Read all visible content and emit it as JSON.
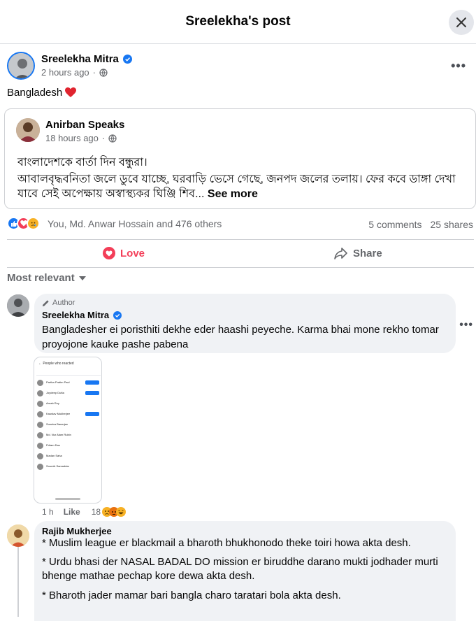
{
  "header": {
    "title": "Sreelekha's post"
  },
  "post": {
    "author": "Sreelekha Mitra",
    "time": "2 hours ago",
    "text": "Bangladesh",
    "shared": {
      "author": "Anirban Speaks",
      "time": "18 hours ago",
      "line1": "বাংলাদেশকে বার্তা দিন বন্ধুরা।",
      "body": "আবালবৃদ্ধবনিতা জলে ডুবে যাচ্ছে, ঘরবাড়ি ভেসে গেছে, জনপদ জলের তলায়। ফের কবে ডাঙ্গা দেখা যাবে সেই অপেক্ষায় অস্বাস্থ্যকর ঘিঞ্জি শিব...",
      "see_more": "See more"
    },
    "reaction_names": "You, Md. Anwar Hossain and 476 others",
    "comments": "5 comments",
    "shares": "25 shares"
  },
  "actions": {
    "love": "Love",
    "share": "Share"
  },
  "sort": {
    "label": "Most relevant"
  },
  "comments": [
    {
      "badge": "Author",
      "name": "Sreelekha Mitra",
      "text": "Bangladesher ei poristhiti dekhe eder haashi peyeche. Karma bhai mone rekho tomar proyojone kauke pashe pabena",
      "attachment": {
        "title": "People who reacted",
        "rows": [
          "Partha Pratim Paul",
          "Joydeep Dutta",
          "Arnab Roy",
          "Kaustav Mukherjee",
          "Sunetra Banerjee",
          "Md. Nur Alam Rubin",
          "Pritam Das",
          "Madan Saha",
          "Soumik Samaddar"
        ]
      },
      "time": "1 h",
      "like": "Like",
      "reaction_count": "18"
    },
    {
      "name": "Rajib Mukherjee",
      "lines": [
        "* Muslim league er blackmail a bharoth bhukhonodo theke toiri howa akta desh.",
        "* Urdu bhasi der NASAL BADAL DO mission er biruddhe darano mukti jodhader murti bhenge mathae pechap kore dewa akta desh.",
        "* Bharoth jader mamar bari bangla charo taratari bola akta desh."
      ]
    }
  ],
  "colors": {
    "love": "#f33e58",
    "like": "#1877f2",
    "verified": "#1877f2"
  }
}
